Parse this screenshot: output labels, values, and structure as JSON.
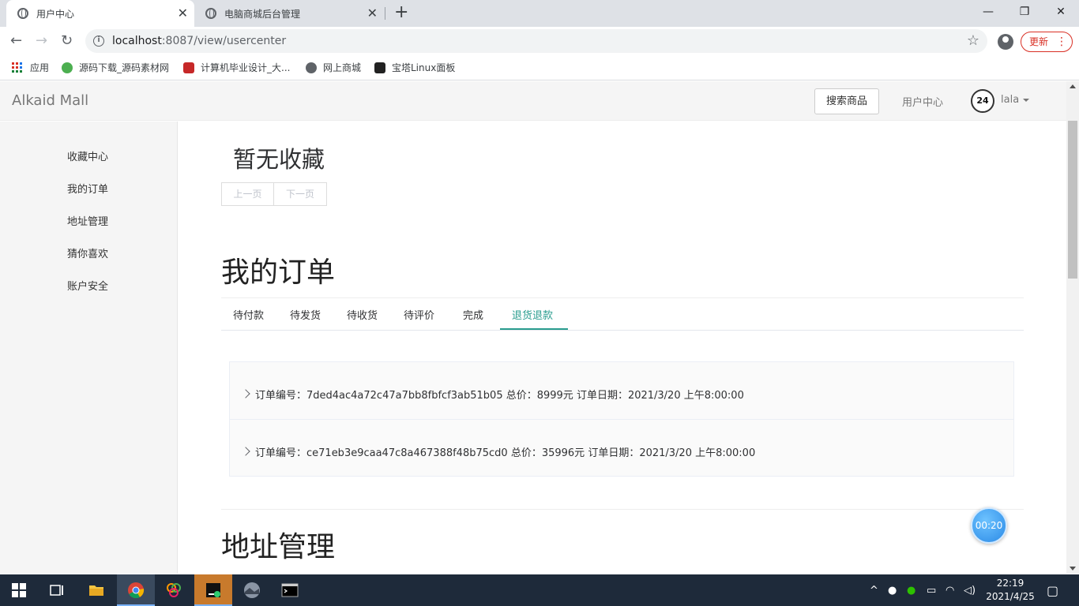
{
  "browser": {
    "tabs": [
      {
        "title": "用户中心",
        "active": true
      },
      {
        "title": "电脑商城后台管理",
        "active": false
      }
    ],
    "url_host": "localhost",
    "url_path": ":8087/view/usercenter",
    "update_label": "更新",
    "bookmarks": [
      "应用",
      "源码下载_源码素材网",
      "计算机毕业设计_大...",
      "网上商城",
      "宝塔Linux面板"
    ]
  },
  "header": {
    "brand": "Alkaid Mall",
    "search_label": "搜索商品",
    "user_center_label": "用户中心",
    "avatar_text": "24",
    "user_name": "lala"
  },
  "sidebar": {
    "items": [
      "收藏中心",
      "我的订单",
      "地址管理",
      "猜你喜欢",
      "账户安全"
    ]
  },
  "favorites": {
    "empty_text": "暂无收藏",
    "prev_label": "上一页",
    "next_label": "下一页"
  },
  "orders": {
    "title": "我的订单",
    "tabs": [
      "待付款",
      "待发货",
      "待收货",
      "待评价",
      "完成",
      "退货退款"
    ],
    "active_tab": "退货退款",
    "items": [
      {
        "text": "订单编号：7ded4ac4a72c47a7bb8fbfcf3ab51b05  总价：8999元 订单日期：2021/3/20 上午8:00:00"
      },
      {
        "text": "订单编号：ce71eb3e9caa47c8a467388f48b75cd0  总价：35996元 订单日期：2021/3/20 上午8:00:00"
      }
    ]
  },
  "address": {
    "title": "地址管理"
  },
  "timer": "00:20",
  "taskbar": {
    "time": "22:19",
    "date": "2021/4/25"
  },
  "colors": {
    "accent": "#2a9d8f",
    "sidebar_bg": "#f5f5f5",
    "taskbar_bg": "#1e2a3a"
  }
}
